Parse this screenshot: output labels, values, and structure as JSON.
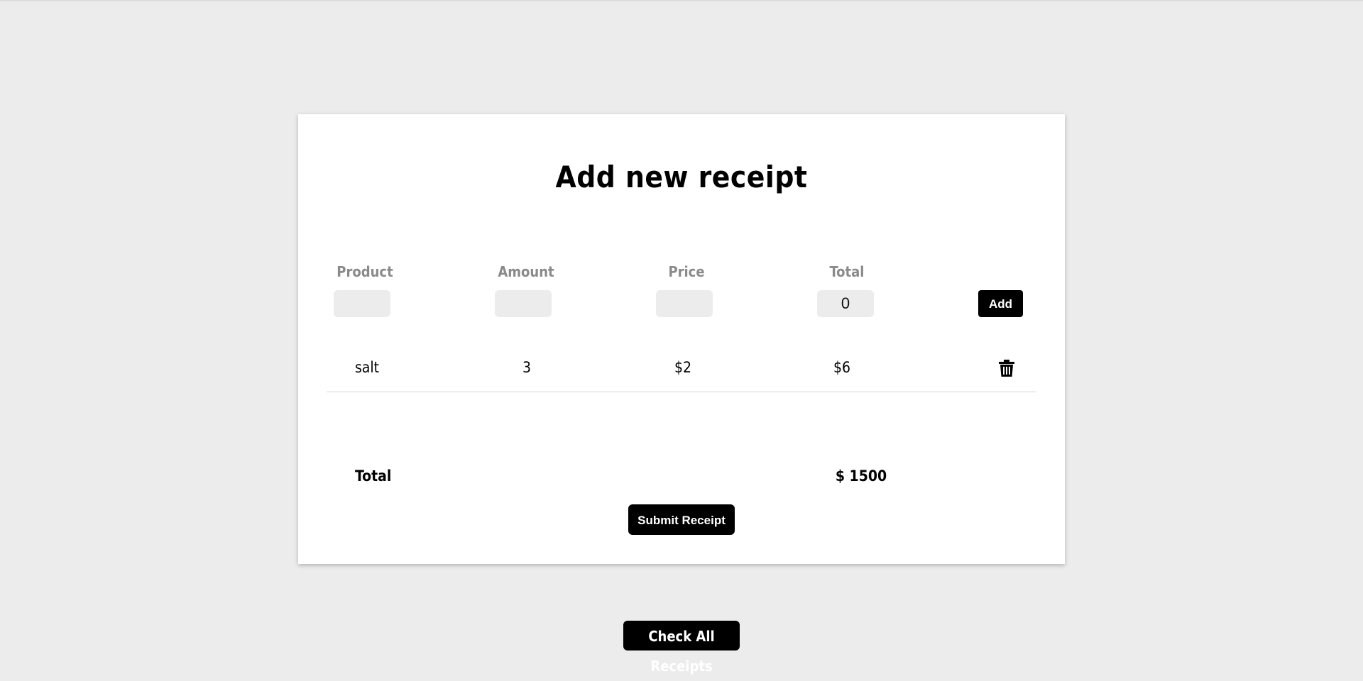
{
  "form": {
    "title": "Add new receipt",
    "columns": {
      "product": "Product",
      "amount": "Amount",
      "price": "Price",
      "total": "Total"
    },
    "inputs": {
      "product_value": "",
      "amount_value": "",
      "price_value": "",
      "total_value": "0"
    },
    "add_label": "Add"
  },
  "items": [
    {
      "product": "salt",
      "amount": "3",
      "price": "$2",
      "total": "$6",
      "delete_icon": "trash-icon"
    }
  ],
  "summary": {
    "label": "Total",
    "value": "$ 1500"
  },
  "buttons": {
    "submit_label": "Submit Receipt",
    "check_all_label": "Check All Receipts"
  },
  "colors": {
    "background": "#ececec",
    "card": "#ffffff",
    "button": "#000000",
    "label_gray": "#8a8a8a",
    "input_bg": "#ececec"
  }
}
